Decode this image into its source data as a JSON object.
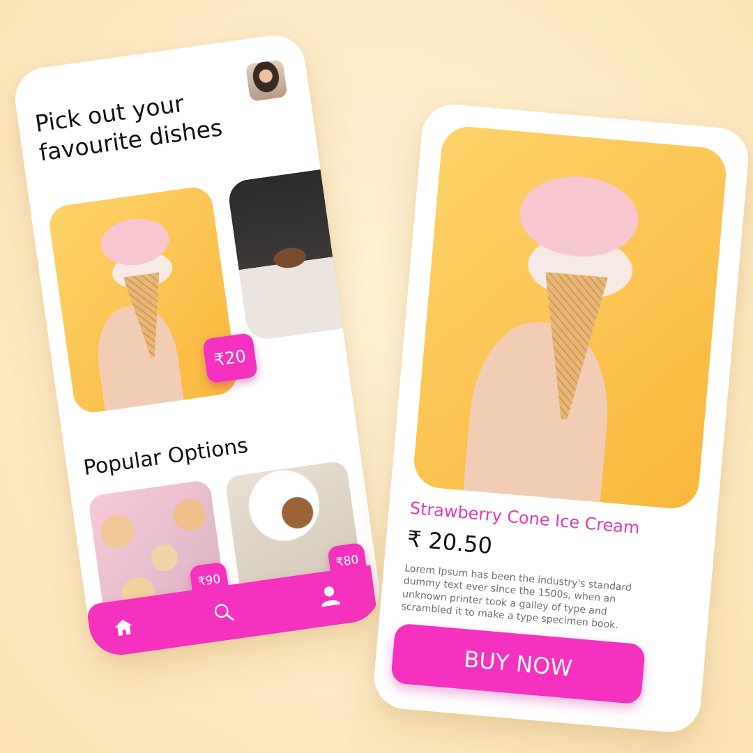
{
  "colors": {
    "accent": "#f531bf",
    "background": "#fde9c4",
    "product_name": "#e13ab7"
  },
  "home": {
    "title_line1": "Pick out your",
    "title_line2": "favourite dishes",
    "avatar_icon": "user-avatar",
    "featured": [
      {
        "price": "₹20",
        "image": "strawberry-ice-cream-cone"
      },
      {
        "image": "chocolate-drip-cake"
      }
    ],
    "popular_title": "Popular Options",
    "popular": [
      {
        "price": "₹90",
        "image": "donuts-with-sprinkles"
      },
      {
        "price": "₹80",
        "image": "chocolate-chip-cookies"
      }
    ],
    "nav": {
      "home_icon": "home-icon",
      "search_icon": "search-icon",
      "profile_icon": "user-icon"
    }
  },
  "detail": {
    "image": "strawberry-ice-cream-cone",
    "name": "Strawberry Cone Ice Cream",
    "price": "₹ 20.50",
    "description": "Lorem Ipsum has been the industry's standard dummy text ever since the 1500s, when an unknown printer took a galley of type and scrambled it to make a type specimen book.",
    "buy_label": "BUY NOW"
  }
}
